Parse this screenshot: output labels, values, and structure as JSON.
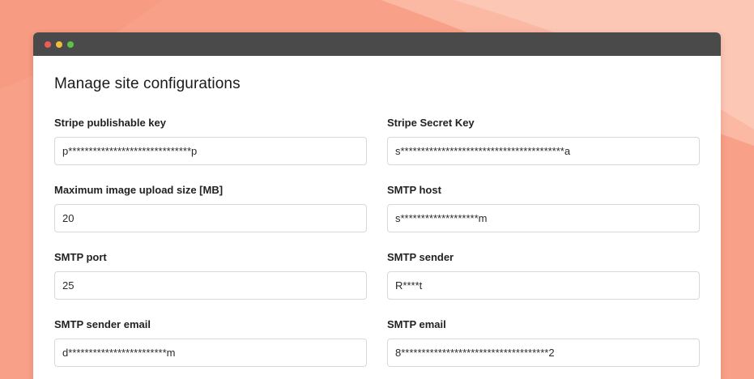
{
  "page": {
    "title": "Manage site configurations"
  },
  "fields": [
    {
      "label": "Stripe publishable key",
      "value": "p******************************p"
    },
    {
      "label": "Stripe Secret Key",
      "value": "s****************************************a"
    },
    {
      "label": "Maximum image upload size [MB]",
      "value": "20"
    },
    {
      "label": "SMTP host",
      "value": "s*******************m"
    },
    {
      "label": "SMTP port",
      "value": "25"
    },
    {
      "label": "SMTP sender",
      "value": "R****t"
    },
    {
      "label": "SMTP sender email",
      "value": "d************************m"
    },
    {
      "label": "SMTP email",
      "value": "8************************************2"
    }
  ],
  "colors": {
    "background": "#f9a58c",
    "background_highlight": "#fcc2ae",
    "titlebar": "#4a4a4a",
    "close_dot": "#ee5b52",
    "minimize_dot": "#f1bd3b",
    "maximize_dot": "#5dc443"
  },
  "icons": [
    "close-dot-icon",
    "minimize-dot-icon",
    "maximize-dot-icon"
  ]
}
